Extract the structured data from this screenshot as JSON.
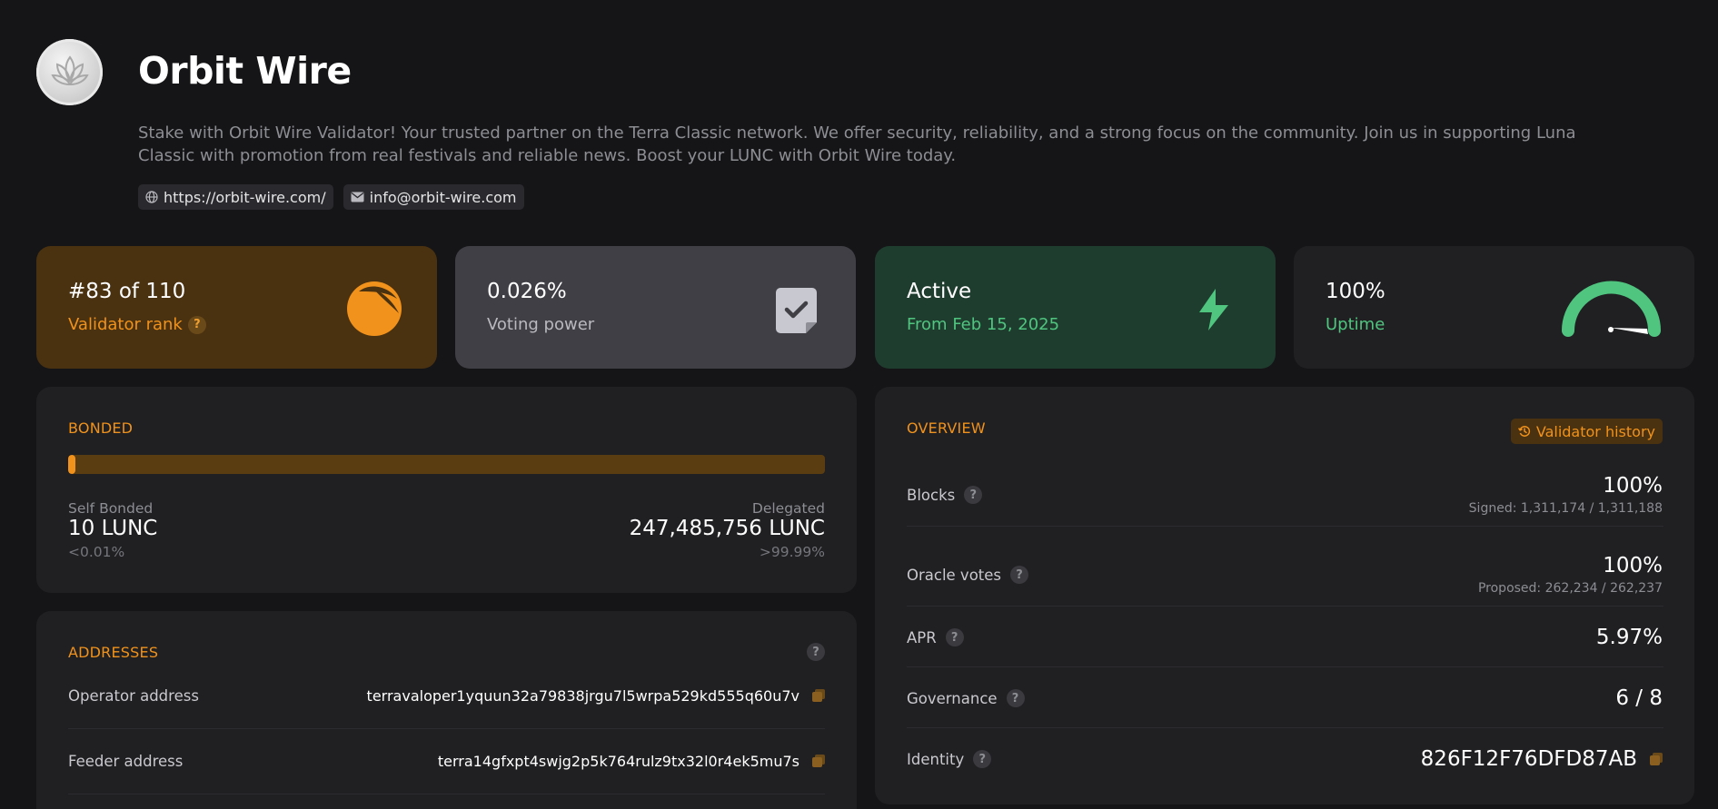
{
  "validator": {
    "name": "Orbit Wire",
    "description": "Stake with Orbit Wire Validator! Your trusted partner on the Terra Classic network. We offer security, reliability, and a strong focus on the community. Join us in supporting Luna Classic with promotion from real festivals and reliable news. Boost your LUNC with Orbit Wire today.",
    "website": "https://orbit-wire.com/",
    "email": "info@orbit-wire.com"
  },
  "stats": {
    "rank": {
      "value": "#83 of 110",
      "label": "Validator rank",
      "help": "?"
    },
    "voting_power": {
      "value": "0.026%",
      "label": "Voting power"
    },
    "status": {
      "value": "Active",
      "label": "From Feb 15, 2025"
    },
    "uptime": {
      "value": "100%",
      "label": "Uptime",
      "level": 1.0
    }
  },
  "bonded": {
    "title": "BONDED",
    "self_fraction": 0.0001,
    "self_label": "Self Bonded",
    "self_value": "10 LUNC",
    "self_pct": "<0.01%",
    "delegated_label": "Delegated",
    "delegated_value": "247,485,756 LUNC",
    "delegated_pct": ">99.99%"
  },
  "addresses": {
    "title": "ADDRESSES",
    "help": "?",
    "rows": [
      {
        "label": "Operator address",
        "value": "terravaloper1yquun32a79838jrgu7l5wrpa529kd555q60u7v"
      },
      {
        "label": "Feeder address",
        "value": "terra14gfxpt4swjg2p5k764rulz9tx32l0r4ek5mu7s"
      }
    ]
  },
  "overview": {
    "title": "OVERVIEW",
    "history_button": "Validator history",
    "help": "?",
    "rows": [
      {
        "label": "Blocks",
        "value": "100%",
        "sub": "Signed: 1,311,174 / 1,311,188"
      },
      {
        "label": "Oracle votes",
        "value": "100%",
        "sub": "Proposed: 262,234 / 262,237"
      },
      {
        "label": "APR",
        "value": "5.97%",
        "sub": ""
      },
      {
        "label": "Governance",
        "value": "6 / 8",
        "sub": ""
      },
      {
        "label": "Identity",
        "value": "826F12F76DFD87AB",
        "sub": ""
      }
    ]
  },
  "colors": {
    "accent": "#f0921b",
    "success": "#4fc57f",
    "background": "#151517",
    "panel": "#202023"
  }
}
